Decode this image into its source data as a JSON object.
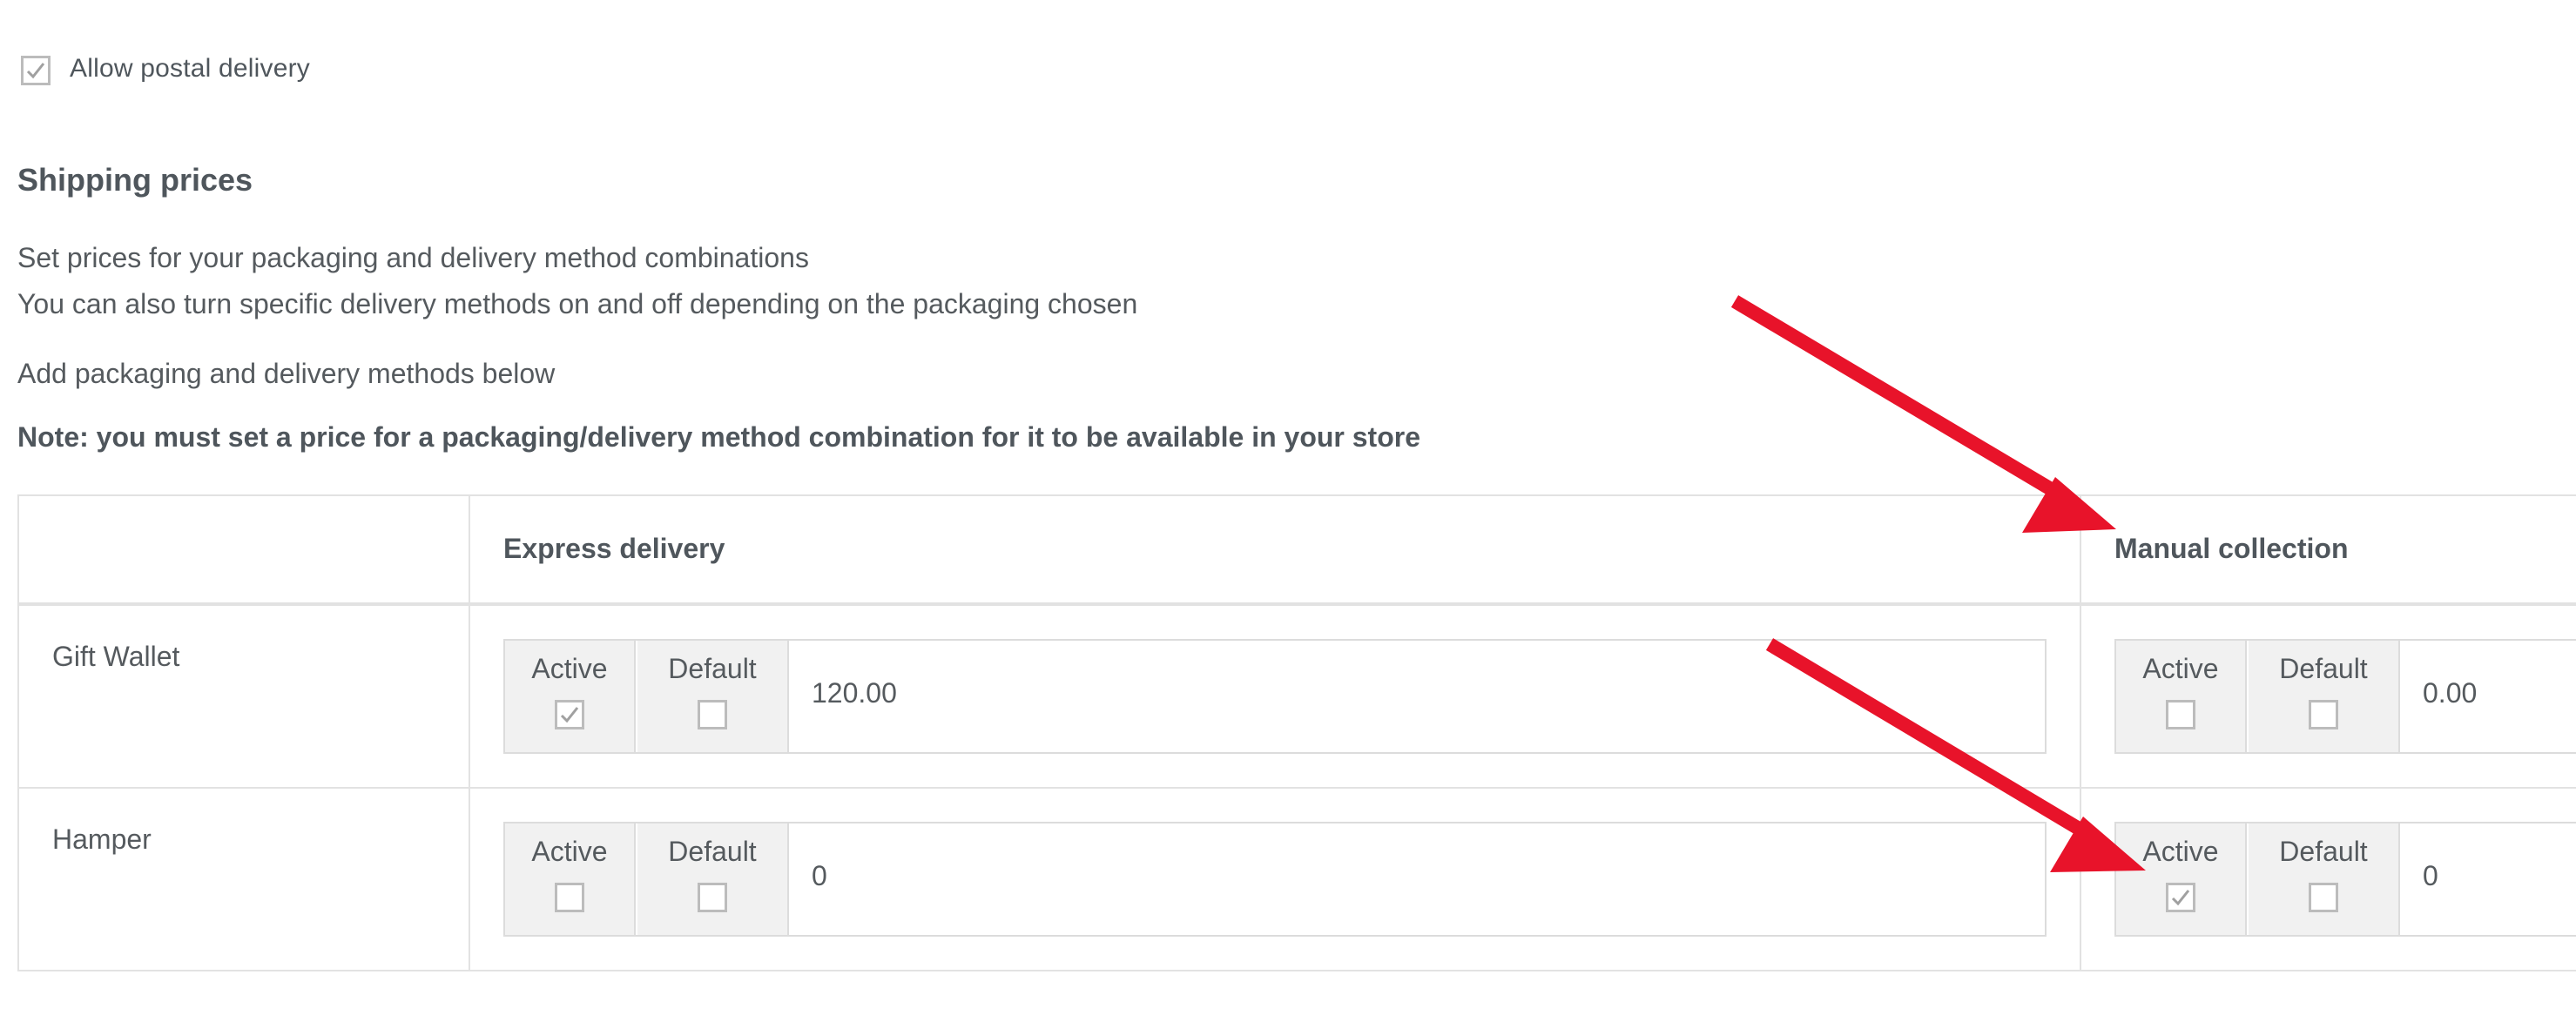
{
  "postal": {
    "label": "Allow postal delivery",
    "checked": true
  },
  "section": {
    "title": "Shipping prices",
    "desc1": "Set prices for your packaging and delivery method combinations",
    "desc2": "You can also turn specific delivery methods on and off depending on the packaging chosen",
    "desc3": "Add packaging and delivery methods below",
    "note": "Note: you must set a price for a packaging/delivery method combination for it to be available in your store"
  },
  "table": {
    "columns": [
      "Express delivery",
      "Manual collection"
    ],
    "active_label": "Active",
    "default_label": "Default",
    "rows": [
      {
        "name": "Gift Wallet",
        "cells": [
          {
            "active": true,
            "default": false,
            "price": "120.00"
          },
          {
            "active": false,
            "default": false,
            "price": "0.00"
          }
        ]
      },
      {
        "name": "Hamper",
        "cells": [
          {
            "active": false,
            "default": false,
            "price": "0"
          },
          {
            "active": true,
            "default": false,
            "price": "0"
          }
        ]
      }
    ]
  },
  "colors": {
    "annotation_arrow": "#e8132a",
    "checkmark": "#a0a0a0"
  }
}
